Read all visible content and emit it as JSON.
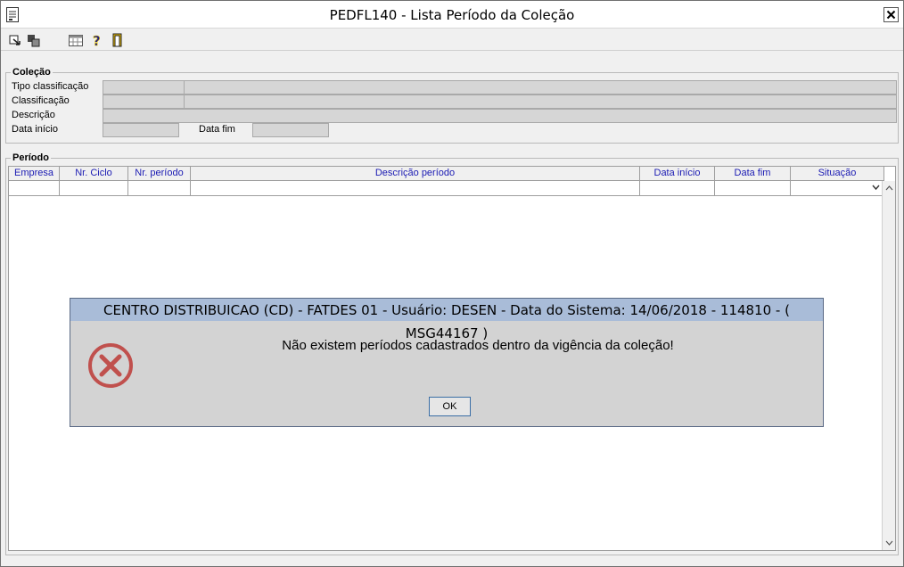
{
  "window": {
    "title": "PEDFL140 - Lista Período da Coleção",
    "close_label": "X"
  },
  "toolbar": {
    "buttons": [
      "export-icon",
      "copy-icon",
      "calendar-grid-icon",
      "help-icon",
      "exit-door-icon"
    ]
  },
  "colecao": {
    "legend": "Coleção",
    "tipo_label": "Tipo classificação",
    "classificacao_label": "Classificação",
    "descricao_label": "Descrição",
    "data_inicio_label": "Data início",
    "data_fim_label": "Data fim"
  },
  "periodo": {
    "legend": "Período",
    "columns": [
      "Empresa",
      "Nr. Ciclo",
      "Nr. período",
      "Descrição período",
      "Data início",
      "Data fim",
      "Situação"
    ]
  },
  "dialog": {
    "title": "CENTRO DISTRIBUICAO (CD) - FATDES 01 - Usuário: DESEN - Data do Sistema: 14/06/2018 - 114810 - ( MSG44167 )",
    "message": "Não existem períodos cadastrados dentro da vigência da coleção!",
    "ok_label": "OK",
    "icon": "error-icon"
  },
  "colors": {
    "dialog_title_bg": "#a9bcd8",
    "header_text": "#1a1ab3",
    "error_red": "#c0504d"
  }
}
